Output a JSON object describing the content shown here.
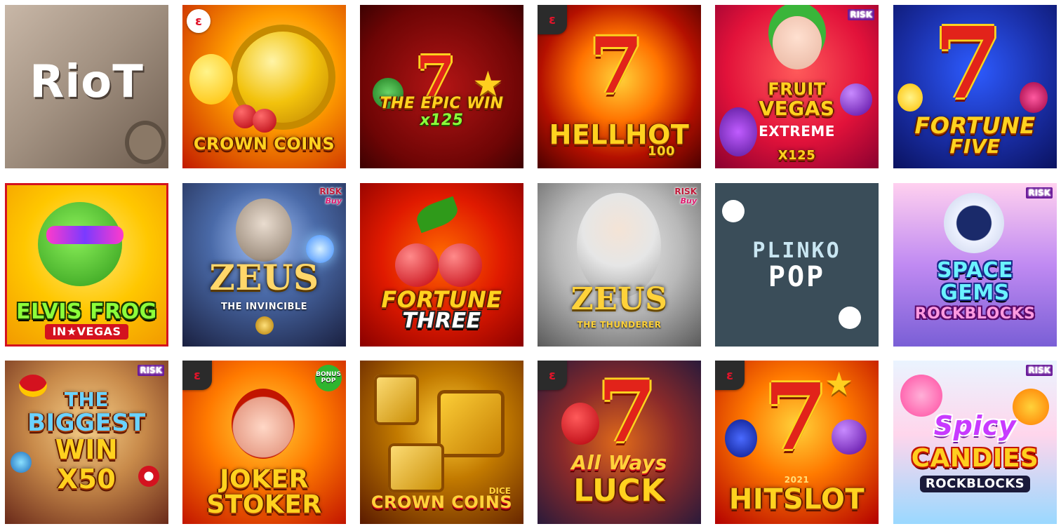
{
  "games": [
    {
      "title_lines": [
        "RioT"
      ],
      "badge": "",
      "badge_sub": "",
      "provider_logo": "none",
      "bg": [
        "#c9b8a6",
        "#7b6a5c"
      ],
      "icon": "riot-graffiti-icon"
    },
    {
      "title_lines": [
        "CROWN COINS"
      ],
      "badge": "",
      "badge_sub": "",
      "provider_logo": "round",
      "bg": [
        "#ffb300",
        "#c21a00"
      ],
      "icon": "gold-coin-icon"
    },
    {
      "title_lines": [
        "THE EPIC WIN",
        "x125"
      ],
      "badge": "",
      "badge_sub": "",
      "provider_logo": "none",
      "bg": [
        "#a10e0e",
        "#4a0303"
      ],
      "icon": "lucky-seven-icon"
    },
    {
      "title_lines": [
        "HELLHOT",
        "100"
      ],
      "badge": "",
      "badge_sub": "",
      "provider_logo": "square",
      "bg": [
        "#ff7a00",
        "#6a0000"
      ],
      "icon": "flaming-seven-icon"
    },
    {
      "title_lines": [
        "FRUIT",
        "VEGAS",
        "EXTREME",
        "X125"
      ],
      "badge": "RISK",
      "badge_sub": "",
      "provider_logo": "none",
      "bg": [
        "#ff3a3a",
        "#b0003a"
      ],
      "icon": "joker-icon"
    },
    {
      "title_lines": [
        "FORTUNE",
        "FIVE"
      ],
      "badge": "",
      "badge_sub": "",
      "provider_logo": "none",
      "bg": [
        "#1f3fc7",
        "#0a1666"
      ],
      "icon": "lucky-seven-icon"
    },
    {
      "title_lines": [
        "ELVIS FROG",
        "IN★VEGAS"
      ],
      "badge": "",
      "badge_sub": "",
      "provider_logo": "none",
      "bg": [
        "#ffd23a",
        "#e38a00"
      ],
      "icon": "frog-icon"
    },
    {
      "title_lines": [
        "ZEUS",
        "THE INVINCIBLE"
      ],
      "badge": "RISK",
      "badge_sub": "Buy",
      "provider_logo": "none",
      "bg": [
        "#5a7fb5",
        "#1c2440"
      ],
      "icon": "zeus-icon"
    },
    {
      "title_lines": [
        "FORTUNE",
        "THREE"
      ],
      "badge": "",
      "badge_sub": "",
      "provider_logo": "none",
      "bg": [
        "#ff3a00",
        "#9a0000"
      ],
      "icon": "cherry-icon"
    },
    {
      "title_lines": [
        "ZEUS",
        "THE THUNDERER"
      ],
      "badge": "RISK",
      "badge_sub": "Buy",
      "provider_logo": "none",
      "bg": [
        "#c9c9c9",
        "#6b6b6b"
      ],
      "icon": "zeus-icon"
    },
    {
      "title_lines": [
        "PLINKO",
        "POP"
      ],
      "badge": "",
      "badge_sub": "",
      "provider_logo": "none",
      "bg": [
        "#3b4f5c",
        "#33454f"
      ],
      "icon": "plinko-ball-icon"
    },
    {
      "title_lines": [
        "SPACE",
        "GEMS",
        "ROCKBLOCKS"
      ],
      "badge": "RISK",
      "badge_sub": "",
      "provider_logo": "none",
      "bg": [
        "#ff9ad0",
        "#7a4fd6"
      ],
      "icon": "astronaut-icon"
    },
    {
      "title_lines": [
        "THE",
        "BIGGEST",
        "WIN",
        "X50"
      ],
      "badge": "RISK",
      "badge_sub": "",
      "provider_logo": "none",
      "bg": [
        "#e8b35a",
        "#8a3a1a"
      ],
      "icon": "crown-icon"
    },
    {
      "title_lines": [
        "JOKER",
        "STOKER"
      ],
      "badge": "BONUS POP",
      "badge_sub": "",
      "provider_logo": "square",
      "bg": [
        "#ffb000",
        "#c21500"
      ],
      "icon": "joker-icon"
    },
    {
      "title_lines": [
        "CROWN COINS"
      ],
      "badge": "DICE",
      "badge_sub": "",
      "provider_logo": "none",
      "bg": [
        "#d9a400",
        "#5a1a00"
      ],
      "icon": "dice-icon"
    },
    {
      "title_lines": [
        "All Ways",
        "LUCK"
      ],
      "badge": "",
      "badge_sub": "",
      "provider_logo": "square",
      "bg": [
        "#c84a1a",
        "#3a1a4a"
      ],
      "icon": "lucky-seven-icon"
    },
    {
      "title_lines": [
        "2021",
        "HITSLOT"
      ],
      "badge": "",
      "badge_sub": "",
      "provider_logo": "square",
      "bg": [
        "#ff9a00",
        "#b30000"
      ],
      "icon": "lucky-seven-icon"
    },
    {
      "title_lines": [
        "Spicy",
        "CANDIES",
        "ROCKBLOCKS"
      ],
      "badge": "RISK",
      "badge_sub": "",
      "provider_logo": "none",
      "bg": [
        "#e6f2ff",
        "#ffb0d8"
      ],
      "icon": "candy-icon"
    }
  ]
}
